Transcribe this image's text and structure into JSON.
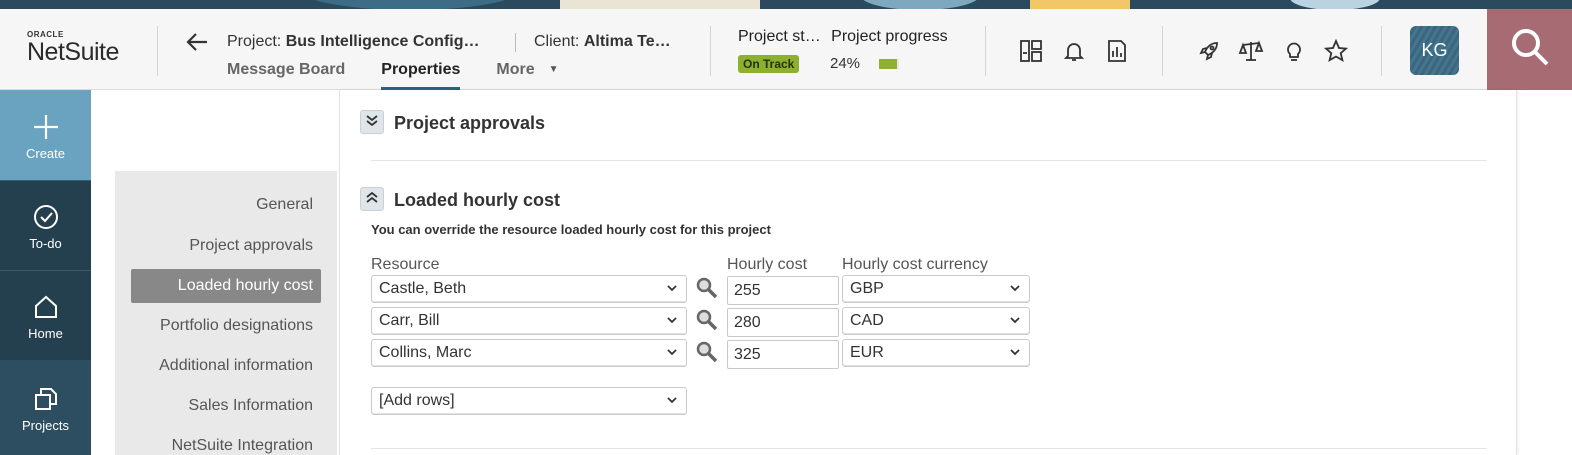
{
  "header": {
    "logo": {
      "oracle": "ORACLE",
      "netsuite": "NetSuite"
    },
    "project_label": "Project:",
    "project_name": "Bus Intelligence Config…",
    "client_label": "Client:",
    "client_name": "Altima Te…",
    "tabs": [
      {
        "label": "Message Board"
      },
      {
        "label": "Properties"
      },
      {
        "label": "More"
      }
    ],
    "status_label": "Project st…",
    "progress_label": "Project  progress",
    "status_badge": "On Track",
    "progress_text": "24%",
    "progress_value": 0.24,
    "avatar_initials": "KG",
    "colors": {
      "accent": "#2f6279",
      "on_track": "#8db12f",
      "search_bg": "#a76b74",
      "nav_bg": "#2b4a5e"
    }
  },
  "header_icons": [
    "dashboard-icon",
    "bell-icon",
    "report-icon",
    "rocket-icon",
    "scales-icon",
    "lightbulb-icon",
    "star-icon",
    "search-icon"
  ],
  "leftnav": {
    "items": [
      {
        "label": "Create",
        "icon": "plus-icon"
      },
      {
        "label": "To-do",
        "icon": "check-circle-icon"
      },
      {
        "label": "Home",
        "icon": "home-icon"
      },
      {
        "label": "Projects",
        "icon": "projects-icon"
      }
    ]
  },
  "sidemenu": {
    "items": [
      {
        "label": "General"
      },
      {
        "label": "Project approvals"
      },
      {
        "label": "Loaded hourly cost"
      },
      {
        "label": "Portfolio designations"
      },
      {
        "label": "Additional information"
      },
      {
        "label": "Sales Information"
      },
      {
        "label": "NetSuite Integration"
      }
    ],
    "active_index": 2
  },
  "main": {
    "section_approvals": {
      "title": "Project approvals"
    },
    "section_cost": {
      "title": "Loaded hourly cost",
      "note": "You can override the resource loaded hourly cost for this project",
      "columns": {
        "resource": "Resource",
        "hourly_cost": "Hourly cost",
        "currency": "Hourly cost currency"
      },
      "rows": [
        {
          "resource": "Castle, Beth",
          "cost": "255",
          "currency": "GBP"
        },
        {
          "resource": "Carr, Bill",
          "cost": "280",
          "currency": "CAD"
        },
        {
          "resource": "Collins, Marc",
          "cost": "325",
          "currency": "EUR"
        }
      ],
      "add_rows": "[Add rows]"
    }
  }
}
